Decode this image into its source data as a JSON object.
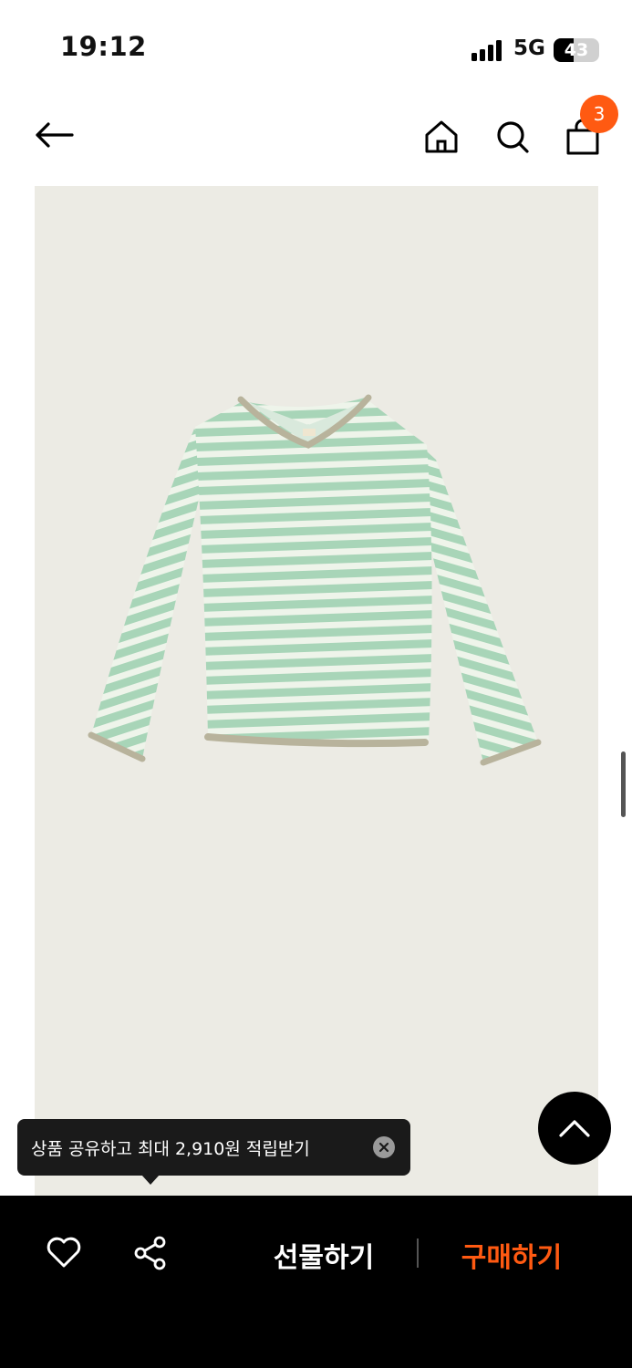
{
  "status_bar": {
    "time": "19:12",
    "network": "5G",
    "battery": "43",
    "battery_level": 0.43
  },
  "nav": {
    "back_icon": "arrow-left-icon",
    "home_icon": "home-icon",
    "search_icon": "search-icon",
    "cart_icon": "shopping-bag-icon",
    "cart_count": "3"
  },
  "product": {
    "image_subject": "mint-white striped hooded long-sleeve top",
    "stripe_color": "#a8d5b8",
    "trim_color": "#b8b39c"
  },
  "tooltip": {
    "text": "상품 공유하고 최대 2,910원 적립받기",
    "close_icon": "close-circle-icon"
  },
  "scroll_top": {
    "icon": "chevron-up-icon"
  },
  "bottom_bar": {
    "like_icon": "heart-icon",
    "share_icon": "share-icon",
    "gift_label": "선물하기",
    "buy_label": "구매하기"
  },
  "colors": {
    "accent": "#ff5a12",
    "background": "#ffffff",
    "image_bg": "#ecebe4",
    "bar_bg": "#000000"
  }
}
